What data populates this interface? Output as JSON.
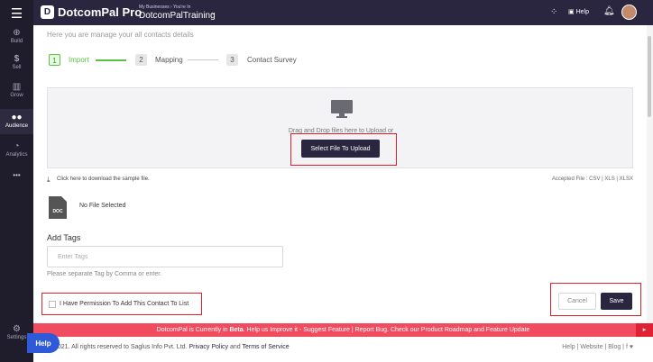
{
  "sidebar": {
    "menu_icon": "hamburger-icon",
    "items": [
      {
        "label": "Build",
        "icon": "plus-circle-icon"
      },
      {
        "label": "Sell",
        "icon": "dollar-icon"
      },
      {
        "label": "Grow",
        "icon": "bar-chart-icon"
      },
      {
        "label": "Audience",
        "icon": "users-icon",
        "active": true
      },
      {
        "label": "Analytics",
        "icon": "pie-chart-icon"
      },
      {
        "label": "•••",
        "icon": "more-icon"
      },
      {
        "label": "Settings",
        "icon": "gear-icon"
      }
    ]
  },
  "topbar": {
    "logo_letter": "D",
    "app_name": "DotcomPal Pro",
    "business_label": "My Businesses › You're In",
    "business_name": "DotcomPalTraining",
    "help_label": "Help"
  },
  "main": {
    "subtitle": "Here you are manage your all contacts details",
    "steps": [
      {
        "number": "1",
        "label": "Import",
        "active": true
      },
      {
        "number": "2",
        "label": "Mapping",
        "active": false
      },
      {
        "number": "3",
        "label": "Contact Survey",
        "active": false
      }
    ],
    "upload": {
      "drag_text": "Drag and Drop files here to Upload or",
      "button_label": "Select File To Upload"
    },
    "download_sample": "Click here to download the sample file.",
    "accepted_files": "Accepted File : CSV | XLS | XLSX",
    "file_icon_label": "DOC",
    "file_status": "No File Selected",
    "tags": {
      "label": "Add Tags",
      "placeholder": "Enter Tags",
      "hint": "Please separate Tag by Comma or enter."
    },
    "permission_label": "I Have Permission To Add This Contact To List",
    "cancel_label": "Cancel",
    "save_label": "Save"
  },
  "beta_bar": {
    "text_before": "DotcomPal is Currently in ",
    "beta_word": "Beta",
    "text_after": ". Help us Improve it - Suggest Feature | Report Bug. Check our Product Roadmap and Feature Update",
    "arrow": "▸"
  },
  "footer": {
    "copyright": "2021. All rights reserved to Saglus Info Pvt. Ltd.",
    "privacy": "Privacy Policy",
    "and": "and",
    "terms": "Terms of Service",
    "links": "Help  |  Website  |  Blog  |  f  ♥"
  },
  "help_widget": {
    "label": "Help"
  },
  "colors": {
    "sidebar_bg": "#1f1c2c",
    "topbar_bg": "#2a2640",
    "step_active": "#5cc244",
    "primary_button": "#2a2640",
    "beta_bar": "#f04b5e",
    "highlight_box": "#e0202a",
    "help_widget": "#2e5ad8"
  }
}
